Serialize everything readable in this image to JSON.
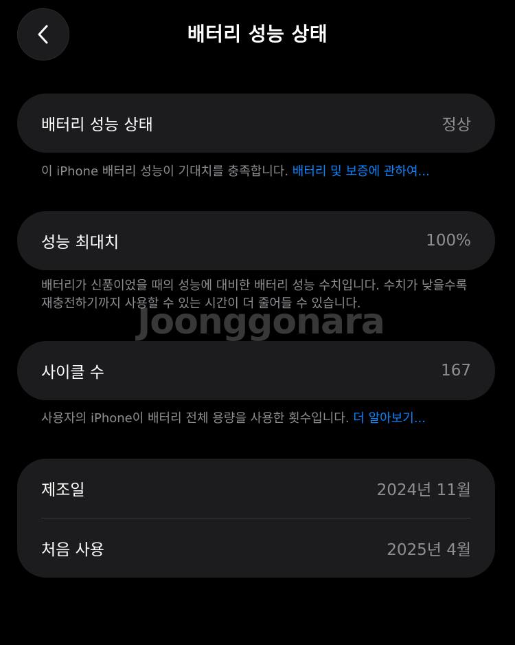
{
  "header": {
    "title": "배터리 성능 상태"
  },
  "sections": {
    "health": {
      "label": "배터리 성능 상태",
      "value": "정상",
      "footnote": "이 iPhone 배터리 성능이 기대치를 충족합니다. ",
      "link": "배터리 및 보증에 관하여..."
    },
    "max_capacity": {
      "label": "성능 최대치",
      "value": "100%",
      "footnote": "배터리가 신품이었을 때의 성능에 대비한 배터리 성능 수치입니다. 수치가 낮을수록 재충전하기까지 사용할 수 있는 시간이 더 줄어들 수 있습니다."
    },
    "cycle_count": {
      "label": "사이클 수",
      "value": "167",
      "footnote": "사용자의 iPhone이 배터리 전체 용량을 사용한 횟수입니다. ",
      "link": "더 알아보기..."
    },
    "dates": {
      "manufacture_label": "제조일",
      "manufacture_value": "2024년 11월",
      "first_use_label": "처음 사용",
      "first_use_value": "2025년 4월"
    }
  },
  "watermark": {
    "text": "Joonggonara"
  },
  "colors": {
    "background": "#000000",
    "card": "#1c1c1e",
    "secondary_text": "#8e8e93",
    "link": "#0a84ff"
  }
}
